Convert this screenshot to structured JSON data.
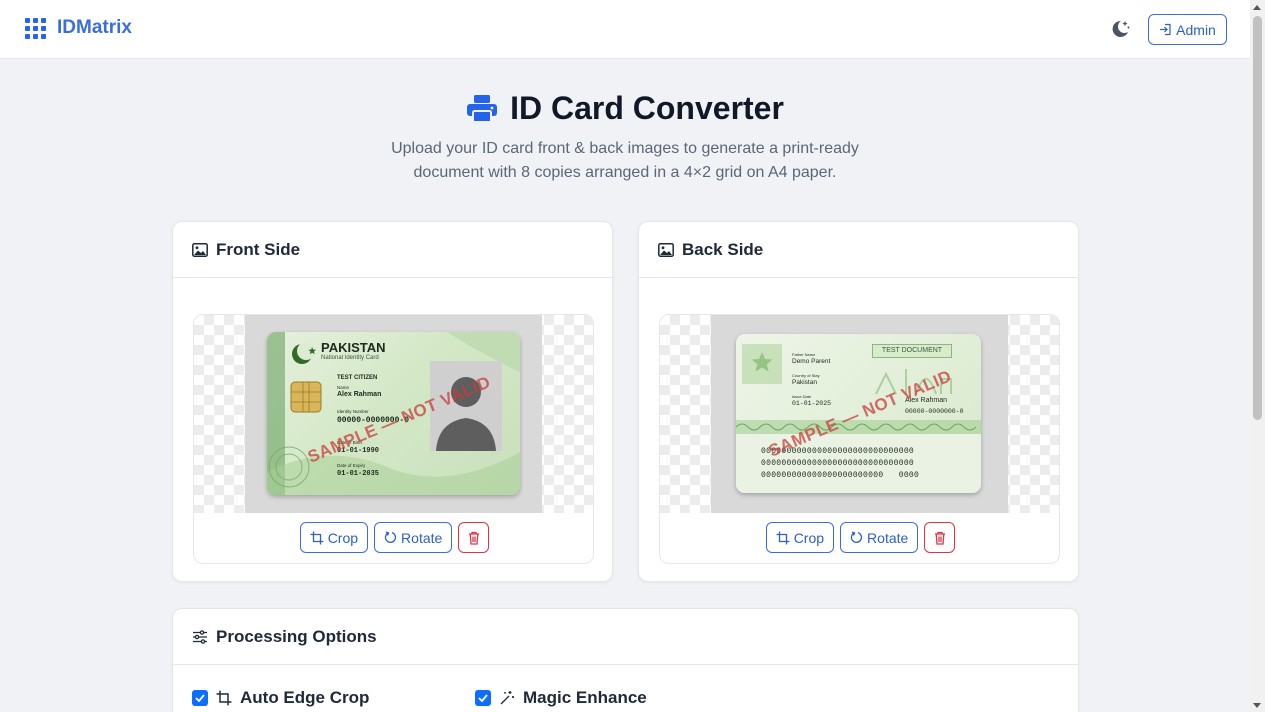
{
  "navbar": {
    "brand": "IDMatrix",
    "admin_label": "Admin"
  },
  "header": {
    "title": "ID Card Converter",
    "subtitle_line1": "Upload your ID card front & back images to generate a print-ready",
    "subtitle_line2": "document with 8 copies arranged in a 4×2 grid on A4 paper."
  },
  "front": {
    "title": "Front Side",
    "card": {
      "country": "PAKISTAN",
      "doc_type": "National Identity Card",
      "line1": "TEST CITIZEN",
      "name_label": "Name",
      "name": "Alex Rahman",
      "id_label": "Identity Number",
      "id_number": "00000-0000000-0",
      "dob_label": "Date of Birth",
      "dob": "01-01-1990",
      "expiry_label": "Date of Expiry",
      "expiry": "01-01-2035",
      "stamp": "SAMPLE — NOT VALID"
    },
    "actions": {
      "crop": "Crop",
      "rotate": "Rotate"
    }
  },
  "back": {
    "title": "Back Side",
    "card": {
      "badge": "TEST DOCUMENT",
      "father_label": "Father Name",
      "father": "Demo Parent",
      "country_label": "Country of Stay",
      "country": "Pakistan",
      "issue_label": "Issue Date",
      "issue": "01-01-2025",
      "name": "Alex Rahman",
      "id_number": "00000-0000000-0",
      "mrz1": "000000000000000000000000000000",
      "mrz2": "000000000000000000000000000000",
      "mrz3": "000000000000000000000000   0000",
      "stamp": "SAMPLE — NOT VALID"
    },
    "actions": {
      "crop": "Crop",
      "rotate": "Rotate"
    }
  },
  "options": {
    "title": "Processing Options",
    "auto_crop": {
      "label": "Auto Edge Crop",
      "checked": true
    },
    "magic_enhance": {
      "label": "Magic Enhance",
      "checked": true
    }
  },
  "colors": {
    "accent": "#2563eb",
    "danger": "#dc3545",
    "background": "#f1f2f6"
  }
}
